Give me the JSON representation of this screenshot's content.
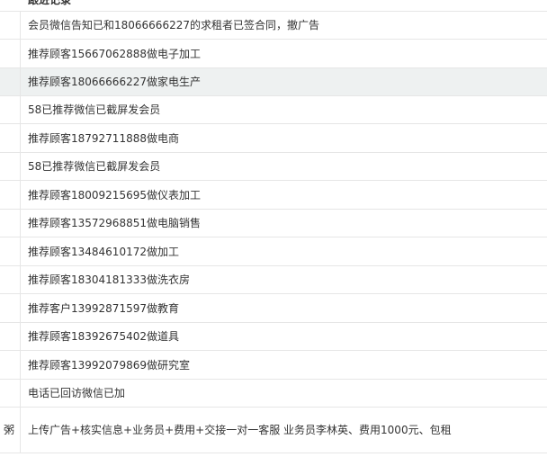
{
  "header": {
    "label": "跟进记录"
  },
  "rows": [
    {
      "left": "",
      "text": "会员微信告知已和18066666227的求租者已签合同，撤广告"
    },
    {
      "left": "",
      "text": "推荐顾客15667062888做电子加工"
    },
    {
      "left": "",
      "text": "推荐顾客18066666227做家电生产"
    },
    {
      "left": "",
      "text": "58已推荐微信已截屏发会员"
    },
    {
      "left": "",
      "text": "推荐顾客18792711888做电商"
    },
    {
      "left": "",
      "text": "58已推荐微信已截屏发会员"
    },
    {
      "left": "",
      "text": "推荐顾客18009215695做仪表加工"
    },
    {
      "left": "",
      "text": "推荐顾客13572968851做电脑销售"
    },
    {
      "left": "",
      "text": "推荐顾客13484610172做加工"
    },
    {
      "left": "",
      "text": "推荐顾客18304181333做洗衣房"
    },
    {
      "left": "",
      "text": "推荐客户13992871597做教育"
    },
    {
      "left": "",
      "text": "推荐顾客18392675402做道具"
    },
    {
      "left": "",
      "text": "推荐顾客13992079869做研究室"
    },
    {
      "left": "",
      "text": "电话已回访微信已加"
    },
    {
      "left": "粥",
      "text": "上传广告+核实信息+业务员+费用+交接一对一客服 业务员李林英、费用1000元、包租"
    }
  ]
}
